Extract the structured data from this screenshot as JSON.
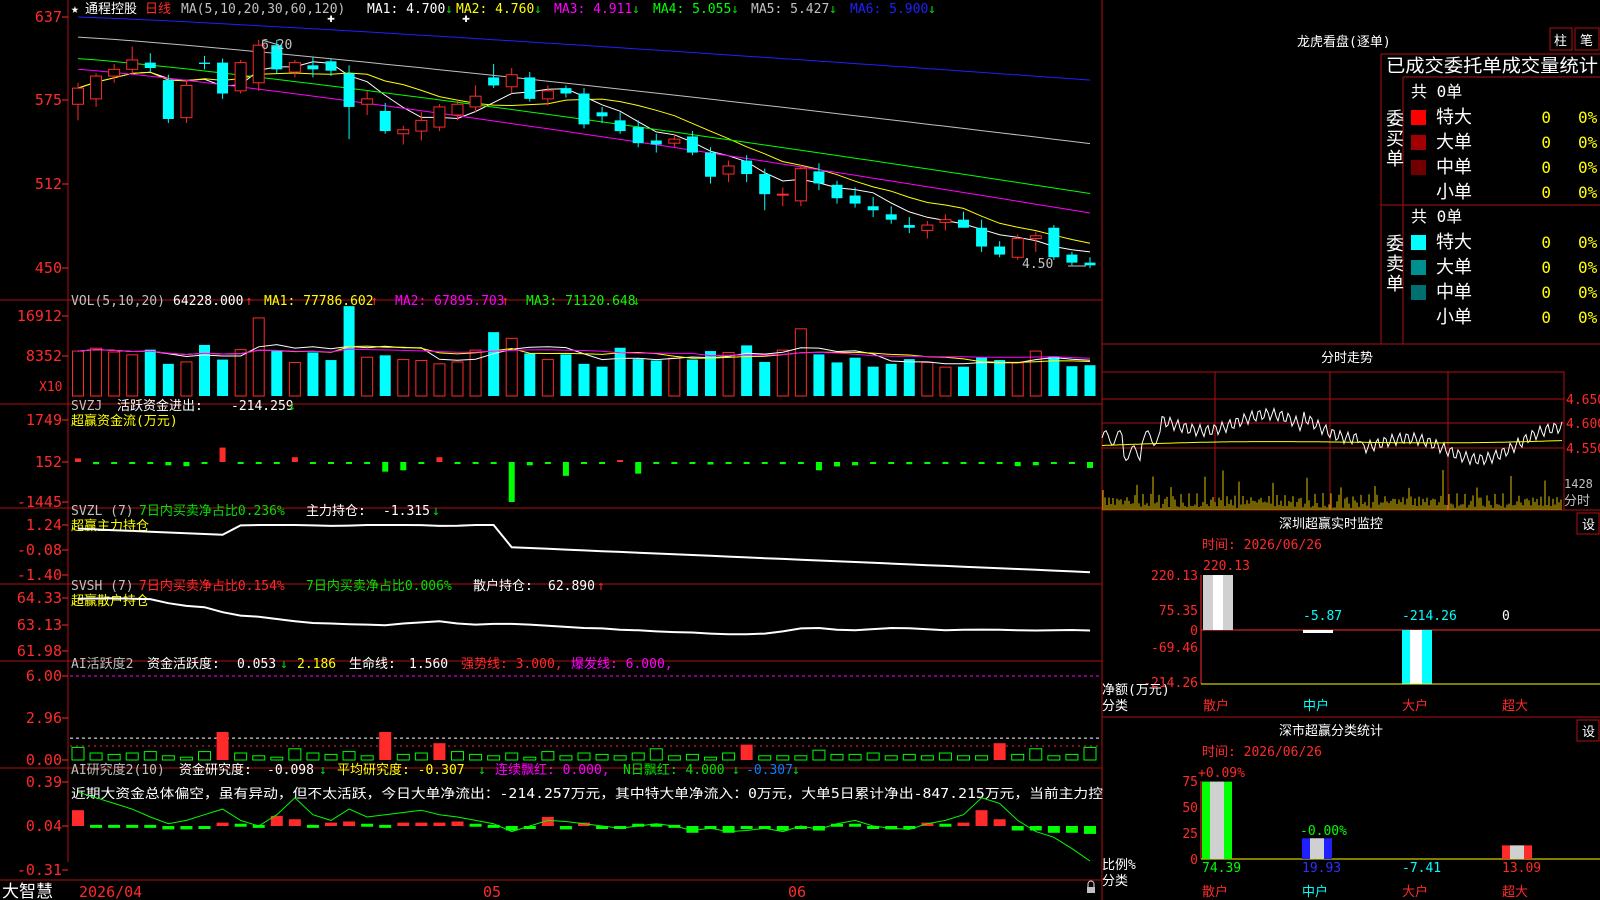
{
  "app": {
    "stock_name": "通程控股",
    "period": "日线",
    "footer": "大智慧",
    "star": "★"
  },
  "colors": {
    "up": "#ff2a2a",
    "down": "#00ffff",
    "grid": "#b01010",
    "text": "#c0c0c0",
    "ma1": "#ffffff",
    "ma2": "#ffff00",
    "ma3": "#ff00ff",
    "ma4": "#00ff00",
    "ma5": "#c0c0c0",
    "ma6": "#2020ff",
    "green": "#00e000"
  },
  "kline": {
    "title": "MA(5,10,20,30,60,120)",
    "ma_readouts": [
      {
        "label": "MA1:",
        "value": "4.700",
        "arrow": "↓"
      },
      {
        "label": "MA2:",
        "value": "4.760",
        "arrow": "↓"
      },
      {
        "label": "MA3:",
        "value": "4.911",
        "arrow": "↓"
      },
      {
        "label": "MA4:",
        "value": "5.055",
        "arrow": "↓"
      },
      {
        "label": "MA5:",
        "value": "5.427",
        "arrow": "↓"
      },
      {
        "label": "MA6:",
        "value": "5.900",
        "arrow": "↓"
      }
    ],
    "axis_ticks": [
      "637",
      "575",
      "512",
      "450"
    ],
    "annot_high": "6.20",
    "annot_low": "4.50"
  },
  "vol": {
    "title": "VOL(5,10,20)",
    "value": "64228.000",
    "value_arrow": "↑",
    "ma_readouts": [
      {
        "label": "MA1:",
        "value": "77786.602",
        "arrow": "↑"
      },
      {
        "label": "MA2:",
        "value": "67895.703",
        "arrow": "↑"
      },
      {
        "label": "MA3:",
        "value": "71120.648",
        "arrow": "↓"
      }
    ],
    "axis_ticks": [
      "16912",
      "8352"
    ],
    "unit": "X10"
  },
  "svzj": {
    "title": "SVZJ",
    "label": "活跃资金进出:",
    "value": "-214.259",
    "arrow": "↓",
    "subtitle": "超赢资金流(万元)",
    "axis_ticks": [
      "1749",
      "152",
      "-1445"
    ]
  },
  "svzl": {
    "title": "SVZL (7)",
    "label1": "7日内买卖净占比0.236%",
    "label2": "主力持仓:",
    "value": "-1.315",
    "arrow": "↓",
    "subtitle": "超赢主力持仓",
    "axis_ticks": [
      "1.24",
      "-0.08",
      "-1.40"
    ]
  },
  "svsh": {
    "title": "SVSH (7)",
    "label1": "7日内买卖净占比0.154%",
    "label2": "7日内买卖净占比0.006%",
    "label3": "散户持仓:",
    "value": "62.890",
    "arrow": "↑",
    "subtitle": "超赢散户持仓",
    "axis_ticks": [
      "64.33",
      "63.13",
      "61.98"
    ]
  },
  "ai_active": {
    "title": "AI活跃度2",
    "label": "资金活跃度:",
    "value": "0.053",
    "arrow": "↓",
    "v2": "2.186",
    "life_label": "生命线:",
    "life": "1.560",
    "strong": "强势线: 3.000,",
    "burst": "爆发线: 6.000,",
    "axis_ticks": [
      "6.00",
      "2.96",
      "0.00"
    ]
  },
  "ai_research": {
    "title": "AI研究度2(10)",
    "label": "资金研究度:",
    "value": "-0.098",
    "arrow": "↓",
    "avg": "平均研究度: -0.307",
    "avg_arrow": "↓",
    "cont": "连续飘红: 0.000,",
    "nday": "N日飘红: 4.000",
    "nday_arrow": "↓",
    "last": "-0.307",
    "last_arrow": "↓",
    "comment": "近期大资金总体偏空，虽有异动，但不太活跃，今日大单净流出：-214.257万元，其中特大单净流入：0万元，大单5日累计净出-847.215万元，当前主力控",
    "axis_ticks": [
      "0.39",
      "0.04",
      "-0.31"
    ]
  },
  "date_axis": [
    "2026/04",
    "05",
    "06"
  ],
  "lhb": {
    "title": "龙虎看盘(逐单)",
    "btn_zhu": "柱",
    "btn_bi": "笔",
    "header": "已成交委托单成交量统计",
    "buy_label": "委买单",
    "sell_label": "委卖单",
    "buy_total": "共 0单",
    "sell_total": "共 0单",
    "buy_rows": [
      {
        "name": "特大",
        "count": "0",
        "pct": "0%",
        "color": "#ff0000"
      },
      {
        "name": "大单",
        "count": "0",
        "pct": "0%",
        "color": "#a00000"
      },
      {
        "name": "中单",
        "count": "0",
        "pct": "0%",
        "color": "#700000"
      },
      {
        "name": "小单",
        "count": "0",
        "pct": "0%",
        "color": ""
      }
    ],
    "sell_rows": [
      {
        "name": "特大",
        "count": "0",
        "pct": "0%",
        "color": "#00ffff"
      },
      {
        "name": "大单",
        "count": "0",
        "pct": "0%",
        "color": "#008f8f"
      },
      {
        "name": "中单",
        "count": "0",
        "pct": "0%",
        "color": "#006f6f"
      },
      {
        "name": "小单",
        "count": "0",
        "pct": "0%",
        "color": ""
      }
    ]
  },
  "intraday": {
    "title": "分时走势",
    "axis_ticks": [
      "4.650",
      "4.600",
      "4.550"
    ],
    "vol_tick": "1428",
    "vol_label": "分时"
  },
  "sz_realtime": {
    "title": "深圳超赢实时监控",
    "settings": "设",
    "time": "时间: 2026/06/26",
    "axis_ticks": [
      "220.13",
      "75.35",
      "0",
      "-69.46",
      "-214.26"
    ],
    "values": [
      {
        "label": "220.13",
        "value": 220.13,
        "color": "#ff2a2a"
      },
      {
        "label": "-5.87",
        "value": -5.87,
        "color": "#00ffff"
      },
      {
        "label": "-214.26",
        "value": -214.26,
        "color": "#00ffff"
      },
      {
        "label": "0",
        "value": 0,
        "color": "#ffffff"
      }
    ],
    "categories": [
      "散户",
      "中户",
      "大户",
      "超大"
    ],
    "cat_colors": [
      "#ff2a2a",
      "#00ffff",
      "#ff2a2a",
      "#ff2a2a"
    ],
    "ylabel1": "净额(万元)",
    "ylabel2": "分类"
  },
  "sz_class": {
    "title": "深市超赢分类统计",
    "settings": "设",
    "time": "时间: 2026/06/26",
    "axis_ticks": [
      "75",
      "50",
      "25",
      "0"
    ],
    "top_labels": [
      "+0.09%",
      "-0.00%",
      "",
      ""
    ],
    "values": [
      74.39,
      19.93,
      -7.41,
      13.09
    ],
    "value_labels": [
      "74.39",
      "19.93",
      "-7.41",
      "13.09"
    ],
    "value_colors": [
      "#00ff00",
      "#3030ff",
      "#00ffff",
      "#ff2a2a"
    ],
    "categories": [
      "散户",
      "中户",
      "大户",
      "超大"
    ],
    "cat_colors": [
      "#ff2a2a",
      "#00ffff",
      "#ff2a2a",
      "#ff2a2a"
    ],
    "ylabel1": "比例%",
    "ylabel2": "分类"
  },
  "chart_data": {
    "type": "bar",
    "title": "通程控股 日线",
    "candles": [
      {
        "o": 5.72,
        "h": 5.88,
        "l": 5.6,
        "c": 5.84
      },
      {
        "o": 5.76,
        "h": 5.95,
        "l": 5.7,
        "c": 5.93
      },
      {
        "o": 5.93,
        "h": 6.02,
        "l": 5.88,
        "c": 5.98
      },
      {
        "o": 5.98,
        "h": 6.15,
        "l": 5.94,
        "c": 6.05
      },
      {
        "o": 6.03,
        "h": 6.1,
        "l": 5.96,
        "c": 5.99
      },
      {
        "o": 5.9,
        "h": 5.94,
        "l": 5.58,
        "c": 5.61
      },
      {
        "o": 5.62,
        "h": 5.9,
        "l": 5.58,
        "c": 5.86
      },
      {
        "o": 6.03,
        "h": 6.08,
        "l": 5.98,
        "c": 6.02
      },
      {
        "o": 6.03,
        "h": 6.06,
        "l": 5.76,
        "c": 5.8
      },
      {
        "o": 5.82,
        "h": 6.05,
        "l": 5.8,
        "c": 6.03
      },
      {
        "o": 5.88,
        "h": 6.2,
        "l": 5.82,
        "c": 6.16
      },
      {
        "o": 6.16,
        "h": 6.2,
        "l": 5.95,
        "c": 5.98
      },
      {
        "o": 5.96,
        "h": 6.05,
        "l": 5.92,
        "c": 6.03
      },
      {
        "o": 6.01,
        "h": 6.07,
        "l": 5.92,
        "c": 5.98
      },
      {
        "o": 6.04,
        "h": 6.06,
        "l": 5.93,
        "c": 5.97
      },
      {
        "o": 5.95,
        "h": 6.01,
        "l": 5.46,
        "c": 5.7
      },
      {
        "o": 5.72,
        "h": 5.82,
        "l": 5.64,
        "c": 5.76
      },
      {
        "o": 5.67,
        "h": 5.73,
        "l": 5.5,
        "c": 5.52
      },
      {
        "o": 5.5,
        "h": 5.56,
        "l": 5.42,
        "c": 5.53
      },
      {
        "o": 5.52,
        "h": 5.66,
        "l": 5.45,
        "c": 5.6
      },
      {
        "o": 5.55,
        "h": 5.72,
        "l": 5.52,
        "c": 5.7
      },
      {
        "o": 5.64,
        "h": 5.75,
        "l": 5.6,
        "c": 5.72
      },
      {
        "o": 5.7,
        "h": 5.86,
        "l": 5.66,
        "c": 5.78
      },
      {
        "o": 5.92,
        "h": 6.02,
        "l": 5.84,
        "c": 5.86
      },
      {
        "o": 5.85,
        "h": 5.99,
        "l": 5.8,
        "c": 5.94
      },
      {
        "o": 5.92,
        "h": 5.96,
        "l": 5.74,
        "c": 5.76
      },
      {
        "o": 5.76,
        "h": 5.86,
        "l": 5.71,
        "c": 5.82
      },
      {
        "o": 5.84,
        "h": 5.86,
        "l": 5.77,
        "c": 5.8
      },
      {
        "o": 5.8,
        "h": 5.84,
        "l": 5.54,
        "c": 5.57
      },
      {
        "o": 5.66,
        "h": 5.7,
        "l": 5.58,
        "c": 5.63
      },
      {
        "o": 5.6,
        "h": 5.66,
        "l": 5.5,
        "c": 5.52
      },
      {
        "o": 5.55,
        "h": 5.6,
        "l": 5.4,
        "c": 5.43
      },
      {
        "o": 5.45,
        "h": 5.5,
        "l": 5.36,
        "c": 5.42
      },
      {
        "o": 5.43,
        "h": 5.5,
        "l": 5.4,
        "c": 5.46
      },
      {
        "o": 5.48,
        "h": 5.52,
        "l": 5.34,
        "c": 5.36
      },
      {
        "o": 5.36,
        "h": 5.4,
        "l": 5.13,
        "c": 5.18
      },
      {
        "o": 5.2,
        "h": 5.3,
        "l": 5.14,
        "c": 5.26
      },
      {
        "o": 5.3,
        "h": 5.34,
        "l": 5.14,
        "c": 5.2
      },
      {
        "o": 5.2,
        "h": 5.24,
        "l": 4.93,
        "c": 5.05
      },
      {
        "o": 5.05,
        "h": 5.1,
        "l": 4.96,
        "c": 5.05
      },
      {
        "o": 5.0,
        "h": 5.27,
        "l": 4.96,
        "c": 5.24
      },
      {
        "o": 5.22,
        "h": 5.28,
        "l": 5.08,
        "c": 5.13
      },
      {
        "o": 5.12,
        "h": 5.15,
        "l": 4.98,
        "c": 5.02
      },
      {
        "o": 5.04,
        "h": 5.1,
        "l": 4.95,
        "c": 4.98
      },
      {
        "o": 4.96,
        "h": 5.03,
        "l": 4.88,
        "c": 4.93
      },
      {
        "o": 4.9,
        "h": 4.96,
        "l": 4.83,
        "c": 4.86
      },
      {
        "o": 4.82,
        "h": 4.88,
        "l": 4.76,
        "c": 4.8
      },
      {
        "o": 4.78,
        "h": 4.85,
        "l": 4.72,
        "c": 4.82
      },
      {
        "o": 4.84,
        "h": 4.9,
        "l": 4.78,
        "c": 4.86
      },
      {
        "o": 4.86,
        "h": 4.92,
        "l": 4.8,
        "c": 4.8
      },
      {
        "o": 4.8,
        "h": 4.86,
        "l": 4.62,
        "c": 4.66
      },
      {
        "o": 4.66,
        "h": 4.7,
        "l": 4.58,
        "c": 4.6
      },
      {
        "o": 4.58,
        "h": 4.75,
        "l": 4.56,
        "c": 4.72
      },
      {
        "o": 4.72,
        "h": 4.77,
        "l": 4.62,
        "c": 4.74
      },
      {
        "o": 4.8,
        "h": 4.82,
        "l": 4.56,
        "c": 4.58
      },
      {
        "o": 4.6,
        "h": 4.62,
        "l": 4.52,
        "c": 4.54
      },
      {
        "o": 4.54,
        "h": 4.58,
        "l": 4.5,
        "c": 4.52
      }
    ],
    "vol_x10": [
      9500,
      10100,
      9300,
      8700,
      9800,
      6800,
      7200,
      10800,
      7700,
      9800,
      16500,
      9500,
      7100,
      9200,
      7600,
      19000,
      8200,
      8600,
      7700,
      7500,
      6800,
      7200,
      9700,
      13500,
      12200,
      9000,
      7700,
      8800,
      6800,
      6200,
      10200,
      7800,
      7500,
      8000,
      7700,
      9500,
      9200,
      10700,
      7200,
      9700,
      14200,
      8800,
      7100,
      8100,
      6200,
      6800,
      7800,
      7100,
      6100,
      6200,
      8200,
      7600,
      7000,
      9500,
      8400,
      6300,
      6500
    ],
    "svzj": [
      150,
      -80,
      -60,
      -40,
      -55,
      -120,
      -150,
      -60,
      600,
      -70,
      -40,
      -25,
      200,
      -60,
      -30,
      -40,
      -25,
      -350,
      -300,
      -60,
      200,
      -50,
      -30,
      -25,
      -1445,
      -120,
      -60,
      -500,
      -35,
      -50,
      30,
      -420,
      -30,
      -25,
      -60,
      -90,
      -40,
      -50,
      -60,
      -80,
      -40,
      -300,
      -160,
      -120,
      -60,
      -40,
      -80,
      -50,
      -60,
      -70,
      -60,
      -40,
      -150,
      -120,
      -60,
      -50,
      -214
    ],
    "active_bars": [
      0.9,
      0.5,
      0.4,
      0.5,
      0.6,
      0.3,
      0.2,
      0.6,
      2.0,
      0.5,
      0.3,
      0.2,
      0.8,
      0.5,
      0.4,
      0.6,
      0.3,
      2.0,
      0.4,
      0.5,
      1.2,
      0.6,
      0.4,
      0.3,
      0.5,
      0.2,
      0.6,
      0.3,
      0.5,
      0.4,
      0.3,
      0.5,
      0.8,
      0.3,
      0.4,
      0.2,
      0.5,
      1.1,
      0.3,
      0.3,
      0.3,
      0.7,
      0.4,
      0.4,
      0.5,
      0.3,
      0.4,
      0.3,
      0.5,
      0.3,
      0.3,
      1.2,
      0.4,
      0.8,
      0.3,
      0.4,
      0.9
    ],
    "research_bars": [
      0.14,
      0.01,
      0.01,
      0.01,
      0.01,
      -0.03,
      -0.03,
      -0.01,
      0.03,
      0.02,
      0.01,
      0.09,
      0.06,
      0.01,
      0.03,
      0.04,
      0.02,
      0.01,
      0.03,
      0.03,
      0.03,
      0.04,
      0.02,
      0.01,
      -0.04,
      -0.02,
      0.08,
      -0.03,
      0.03,
      -0.02,
      -0.01,
      0.02,
      0.02,
      0.01,
      -0.06,
      -0.02,
      -0.06,
      -0.02,
      -0.02,
      -0.04,
      -0.02,
      -0.04,
      0.02,
      0.02,
      -0.02,
      -0.03,
      -0.02,
      0.03,
      0.02,
      0.03,
      0.14,
      0.06,
      -0.04,
      -0.04,
      -0.06,
      -0.06,
      -0.07
    ]
  }
}
